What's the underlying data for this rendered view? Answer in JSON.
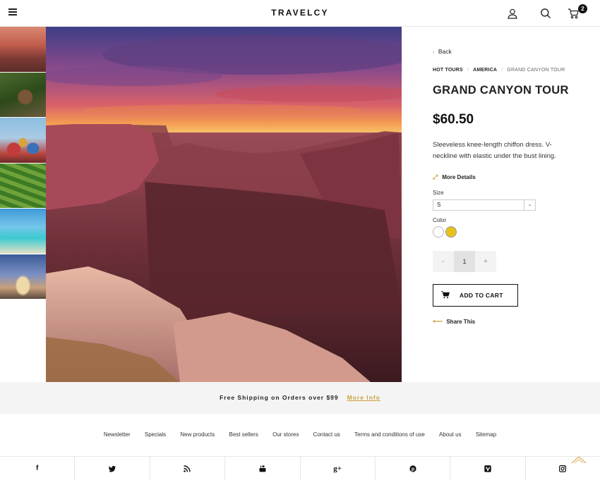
{
  "header": {
    "logo": "TRAVELCY",
    "cart_count": "2",
    "icons": [
      "menu-icon",
      "user-icon",
      "search-icon",
      "cart-icon"
    ]
  },
  "gallery": {
    "thumbnails": [
      "Grand Canyon",
      "Monkey",
      "St. Basil's Cathedral",
      "Rice terraces",
      "Longtail boat",
      "Louvre pyramid"
    ]
  },
  "product": {
    "back_label": "Back",
    "breadcrumb": [
      "HOT TOURS",
      "AMERICA",
      "GRAND CANYON TOUR"
    ],
    "title": "GRAND CANYON TOUR",
    "price": "$60.50",
    "description": "Sleeveless knee-length chiffon dress. V-neckline with elastic under the bust lining.",
    "more_details_label": "More Details",
    "size_label": "Size",
    "size_value": "S",
    "color_label": "Color",
    "colors": [
      "#ffffff",
      "#e7c21b"
    ],
    "qty_minus": "-",
    "qty_value": "1",
    "qty_plus": "+",
    "add_to_cart_label": "ADD TO CART",
    "share_label": "Share This"
  },
  "shipping": {
    "text": "Free Shipping on Orders over $99",
    "link": "More Info"
  },
  "footer": {
    "links": [
      "Newsletter",
      "Specials",
      "New products",
      "Best sellers",
      "Our stores",
      "Contact us",
      "Terms and conditions of use",
      "About us",
      "Sitemap"
    ],
    "social": [
      "facebook-icon",
      "twitter-icon",
      "rss-icon",
      "youtube-icon",
      "google-plus-icon",
      "pinterest-icon",
      "vimeo-icon",
      "instagram-icon"
    ]
  },
  "colors": {
    "accent": "#c9a13a",
    "text": "#222222",
    "banner_bg": "#f4f4f4"
  }
}
